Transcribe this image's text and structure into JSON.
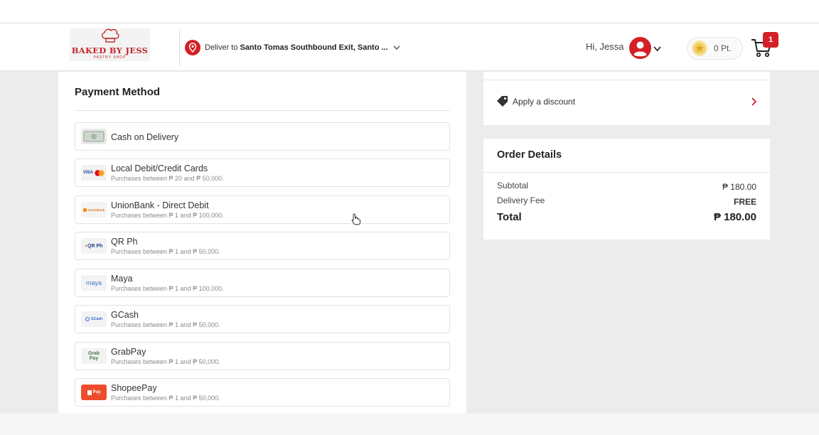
{
  "header": {
    "logo_title": "BAKED BY JESS",
    "logo_subtitle": "PASTRY SHOP",
    "deliver_prefix": "Deliver to",
    "deliver_address": "Santo Tomas Southbound Exit, Santo ...",
    "greeting": "Hi, Jessa",
    "points": "0 Pt.",
    "cart_count": "1"
  },
  "payment": {
    "title": "Payment Method",
    "options": [
      {
        "name": "Cash on Delivery",
        "sub": "",
        "logo": ""
      },
      {
        "name": "Local Debit/Credit Cards",
        "sub": "Purchases between ₱ 20 and ₱ 50,000.",
        "logo": "VISA"
      },
      {
        "name": "UnionBank - Direct Debit",
        "sub": "Purchases between ₱ 1 and ₱ 100,000.",
        "logo": "UnionBank"
      },
      {
        "name": "QR Ph",
        "sub": "Purchases between ₱ 1 and ₱ 50,000.",
        "logo": "QR Ph"
      },
      {
        "name": "Maya",
        "sub": "Purchases between ₱ 1 and ₱ 100,000.",
        "logo": "maya"
      },
      {
        "name": "GCash",
        "sub": "Purchases between ₱ 1 and ₱ 50,000.",
        "logo": "GCash"
      },
      {
        "name": "GrabPay",
        "sub": "Purchases between ₱ 1 and ₱ 50,000.",
        "logo": "Grab Pay"
      },
      {
        "name": "ShopeePay",
        "sub": "Purchases between ₱ 1 and ₱ 50,000.",
        "logo": "Pay"
      }
    ]
  },
  "discount": {
    "label": "Apply a discount"
  },
  "order": {
    "title": "Order Details",
    "subtotal_label": "Subtotal",
    "subtotal_value": "₱ 180.00",
    "delivery_label": "Delivery Fee",
    "delivery_value": "FREE",
    "total_label": "Total",
    "total_value": "₱ 180.00"
  },
  "colors": {
    "brand_red": "#c1272d",
    "badge_red": "#d32027",
    "shopee_orange": "#ee4d2d"
  },
  "icons": [
    "chef-hat-icon",
    "location-pin-icon",
    "chevron-down-icon",
    "avatar-icon",
    "star-coin-icon",
    "cart-icon",
    "tag-icon",
    "chevron-right-icon",
    "cash-icon",
    "hand-cursor-icon"
  ]
}
